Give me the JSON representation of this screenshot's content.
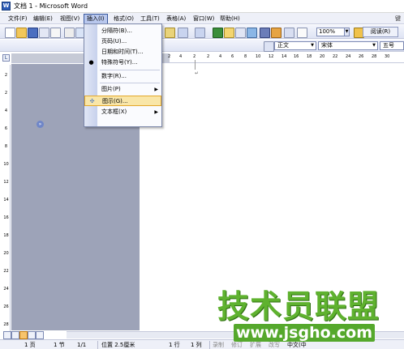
{
  "window": {
    "title": "文档 1 - Microsoft Word",
    "app_icon": "W"
  },
  "menubar": {
    "items": [
      "文件(F)",
      "编辑(E)",
      "视图(V)",
      "插入(I)",
      "格式(O)",
      "工具(T)",
      "表格(A)",
      "窗口(W)",
      "帮助(H)"
    ],
    "active_index": 3,
    "right_label": "键"
  },
  "toolbar": {
    "zoom": "100%",
    "read_button": "阅读(R)"
  },
  "formatting": {
    "style": "正文",
    "font": "宋体",
    "size": "五号"
  },
  "ruler": {
    "numbers": [
      "2",
      "4",
      "2",
      "2",
      "4",
      "6",
      "8",
      "10",
      "12",
      "14",
      "16",
      "18",
      "20",
      "22",
      "24",
      "26",
      "28",
      "30"
    ],
    "corner": "L",
    "vertical_numbers": [
      "2",
      "2",
      "4",
      "6",
      "8",
      "10",
      "12",
      "14",
      "16",
      "18",
      "20",
      "22",
      "24",
      "26",
      "28"
    ]
  },
  "insert_menu": {
    "items": [
      {
        "label": "分隔符(B)...",
        "icon": "",
        "submenu": false
      },
      {
        "label": "页码(U)...",
        "icon": "",
        "submenu": false
      },
      {
        "label": "日期和时间(T)...",
        "icon": "",
        "submenu": false
      },
      {
        "label": "特殊符号(Y)...",
        "icon": "",
        "submenu": false
      },
      {
        "label": "数字(R)...",
        "icon": "",
        "submenu": false
      },
      {
        "label": "图片(P)",
        "icon": "",
        "submenu": true
      },
      {
        "label": "图示(G)...",
        "icon": "diagram-icon",
        "submenu": false
      },
      {
        "label": "文本框(X)",
        "icon": "",
        "submenu": true
      }
    ],
    "highlighted_index": 6,
    "arrow_glyph": "▶",
    "more_glyph": "»"
  },
  "document": {
    "paragraph_mark": "↵"
  },
  "statusbar": {
    "page": "1 页",
    "section": "1 节",
    "page_of": "1/1",
    "position": "位置 2.5厘米",
    "line": "1 行",
    "column": "1 列",
    "record": "录制",
    "revise": "修订",
    "extend": "扩展",
    "overtype": "改写",
    "language": "中文(中"
  },
  "watermark": {
    "title": "技术员联盟",
    "url": "www.jsgho.com"
  },
  "colors": {
    "menu_bg": "#eef0f8",
    "highlight": "#f9e6a8",
    "gray_area": "#9da3b8",
    "watermark_green": "#5fb22f"
  }
}
